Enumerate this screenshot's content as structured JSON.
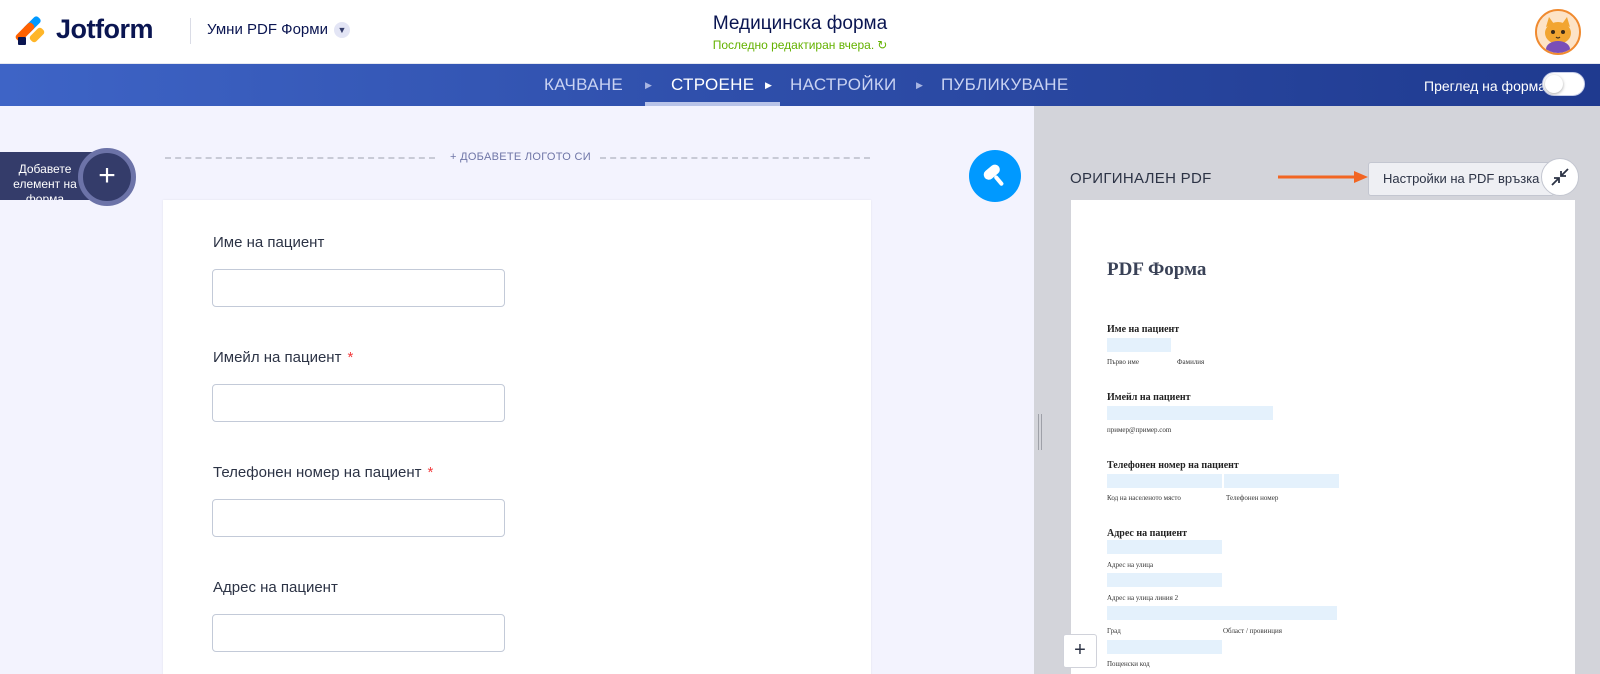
{
  "header": {
    "brand": "Jotform",
    "product": "Умни PDF Форми",
    "form_title": "Медицинска форма",
    "last_edited": "Последно редактиран вчера."
  },
  "nav": {
    "tabs": [
      {
        "label": "КАЧВАНЕ",
        "active": false
      },
      {
        "label": "СТРОЕНЕ",
        "active": true
      },
      {
        "label": "НАСТРОЙКИ",
        "active": false
      },
      {
        "label": "ПУБЛИКУВАНЕ",
        "active": false
      }
    ],
    "preview_label": "Преглед на форма",
    "preview_enabled": false
  },
  "builder": {
    "add_element_label": "Добавете елемент на форма",
    "add_logo_label": "+ ДОБАВЕТЕ ЛОГОТО СИ",
    "fields": [
      {
        "label": "Име на пациент",
        "required": false
      },
      {
        "label": "Имейл на пациент",
        "required": true
      },
      {
        "label": "Телефонен номер на пациент",
        "required": true
      },
      {
        "label": "Адрес на пациент",
        "required": false
      }
    ],
    "required_mark": "*"
  },
  "pdf": {
    "pane_title": "ОРИГИНАЛЕН PDF",
    "settings_button": "Настройки на PDF връзка",
    "heading": "PDF Форма",
    "labels": {
      "name": "Име на пациент",
      "email": "Имейл на пациент",
      "phone": "Телефонен номер на пациент",
      "address": "Адрес на пациент"
    },
    "sublabels": {
      "first_name": "Първо име",
      "last_name": "Фамилия",
      "email_example": "пример@пример.com",
      "area_code": "Код на населеното място",
      "phone_number": "Телефонен номер",
      "street": "Адрес на улица",
      "street2": "Адрес на улица линия 2",
      "city": "Град",
      "region": "Област / провинция",
      "postal": "Пощенски код"
    },
    "zoom_in": "+"
  },
  "colors": {
    "brand_navy": "#0a1551",
    "nav_blue": "#2f4fab",
    "accent_blue": "#0099ff",
    "required_red": "#f23a3c",
    "arrow_orange": "#f26522",
    "edited_green": "#64b200"
  }
}
